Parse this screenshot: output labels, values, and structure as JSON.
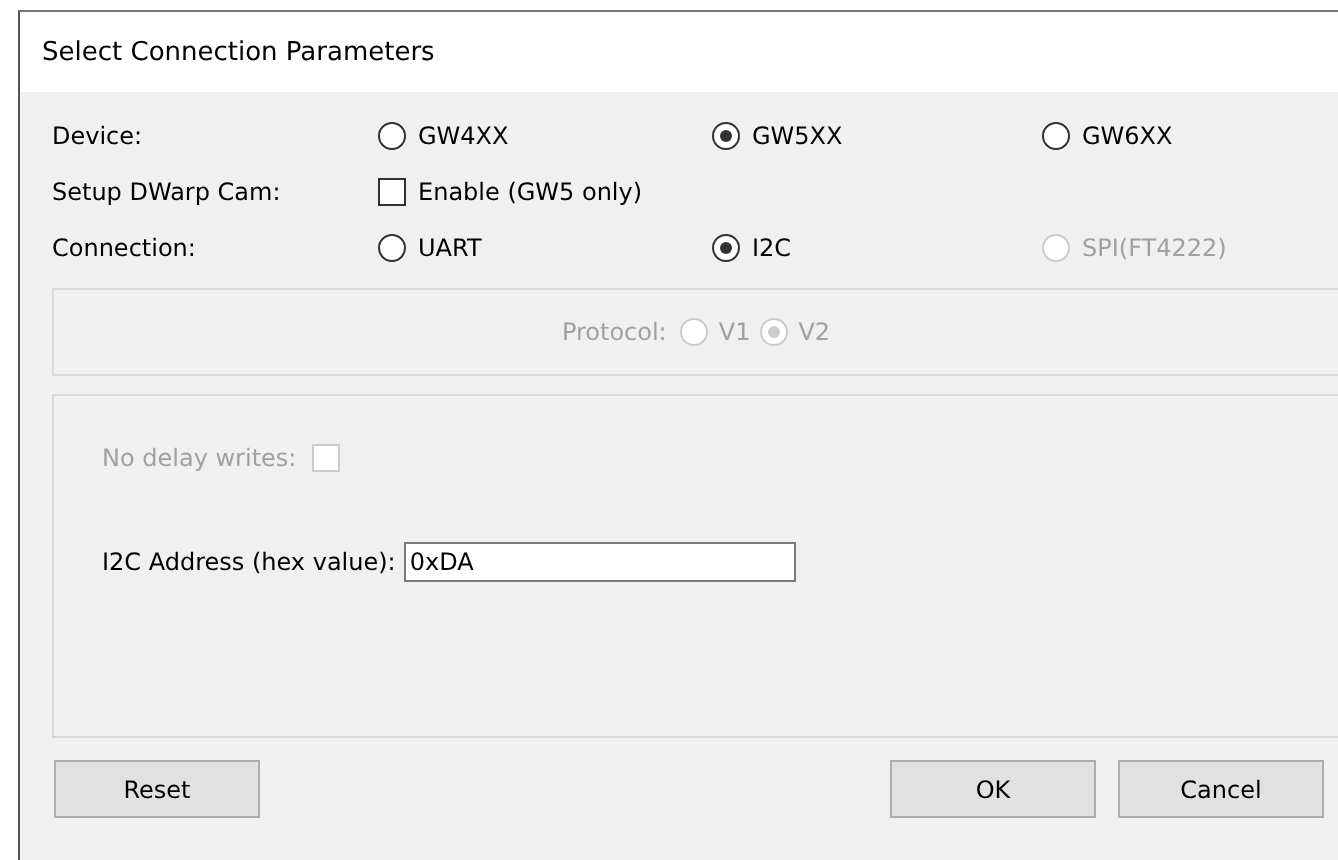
{
  "window": {
    "title": "Select Connection Parameters"
  },
  "rows": [
    {
      "label": "Device:",
      "kind": "radio",
      "options": [
        {
          "label": "GW4XX",
          "selected": false,
          "disabled": false
        },
        {
          "label": "GW5XX",
          "selected": true,
          "disabled": false
        },
        {
          "label": "GW6XX",
          "selected": false,
          "disabled": false
        }
      ]
    },
    {
      "label": "Setup DWarp Cam:",
      "kind": "checkbox",
      "options": [
        {
          "label": "Enable (GW5 only)",
          "checked": false
        }
      ]
    },
    {
      "label": "Connection:",
      "kind": "radio",
      "options": [
        {
          "label": "UART",
          "selected": false,
          "disabled": false
        },
        {
          "label": "I2C",
          "selected": true,
          "disabled": false
        },
        {
          "label": "SPI(FT4222)",
          "selected": false,
          "disabled": true
        }
      ]
    }
  ],
  "protocol": {
    "label": "Protocol:",
    "disabled": true,
    "options": [
      {
        "label": "V1",
        "selected": false
      },
      {
        "label": "V2",
        "selected": true
      }
    ]
  },
  "settings": {
    "no_delay": {
      "label": "No delay writes:",
      "checked": false,
      "disabled": true
    },
    "address": {
      "label": "I2C Address (hex value):",
      "value": "0xDA"
    }
  },
  "buttons": [
    "Reset",
    "OK",
    "Cancel"
  ]
}
